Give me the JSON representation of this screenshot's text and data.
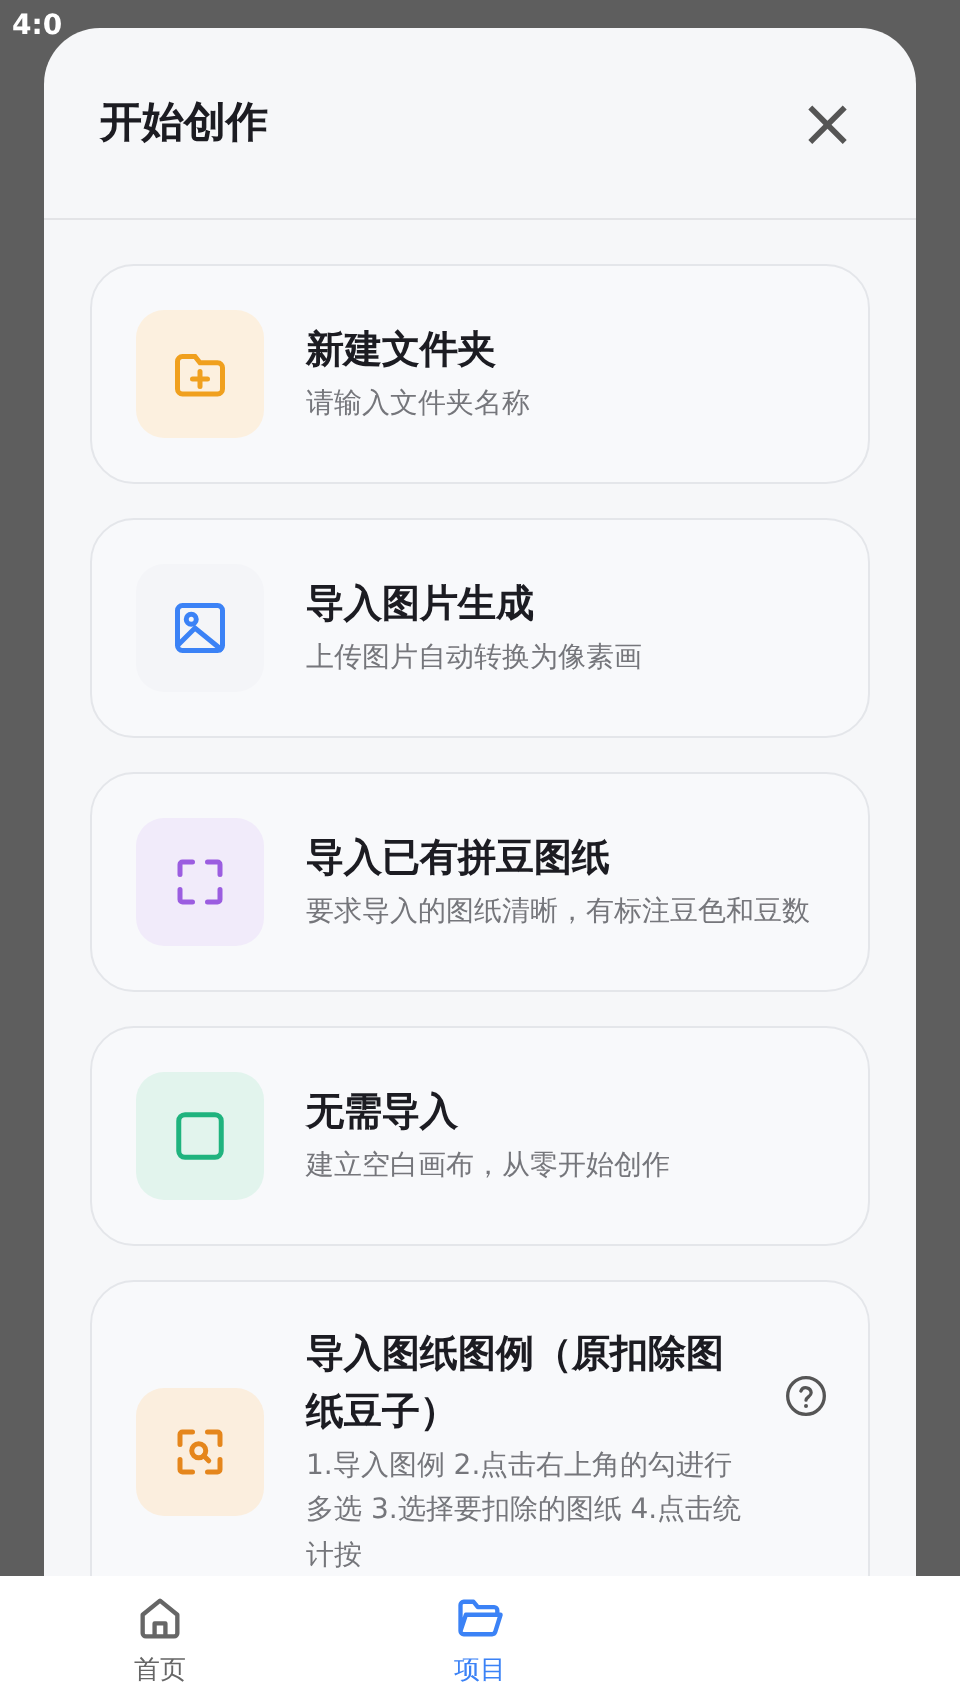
{
  "status_bar": {
    "time": "4:0"
  },
  "sheet": {
    "title": "开始创作",
    "close": "×"
  },
  "options": [
    {
      "kind": "plain",
      "title": "新建文件夹",
      "description": "请输入文件夹名称",
      "color": "#f0a01e"
    },
    {
      "kind": "plain",
      "title": "导入图片生成",
      "description": "上传图片自动转换为像素画",
      "color": "#3b82f6"
    },
    {
      "kind": "plain",
      "title": "导入已有拼豆图纸",
      "description": "要求导入的图纸清晰，有标注豆色和豆数",
      "color": "#9b5de0"
    },
    {
      "kind": "plain",
      "title": "无需导入",
      "description": "建立空白画布，从零开始创作",
      "color": "#1fb37e"
    },
    {
      "kind": "help",
      "title": "导入图纸图例（原扣除图纸豆子）",
      "description": "1.导入图例 2.点击右上角的勾进行多选 3.选择要扣除的图纸 4.点击统计按",
      "color": "#e5861c"
    }
  ],
  "bottom_nav": [
    {
      "label": "首页",
      "selected": false
    },
    {
      "label": "项目",
      "selected": true
    }
  ]
}
